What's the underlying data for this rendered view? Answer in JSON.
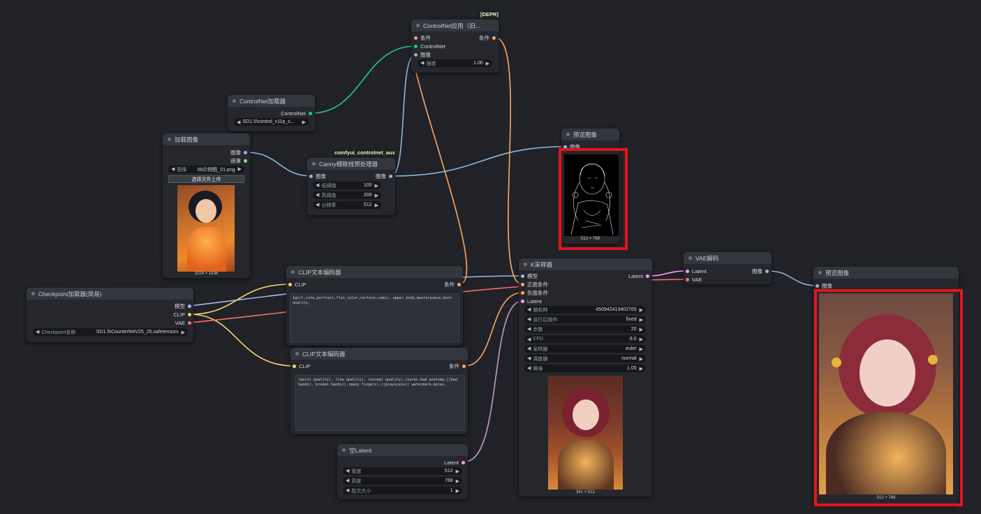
{
  "colors": {
    "model": "#a9b4e8",
    "clip": "#ffd36e",
    "vae": "#ff6e6e",
    "conditioning": "#ffa763",
    "controlnet": "#22c98a",
    "image": "#8fb8dc",
    "latent": "#ff9cf9",
    "mask": "#8fde8a",
    "highlight": "#e3151b"
  },
  "badges": {
    "depr": "[DEPR]",
    "aux": "comfyui_controlnet_aux"
  },
  "controlnet_apply": {
    "title": "ControlNet应用（旧...",
    "in_conditioning": "条件",
    "in_controlnet": "ControlNet",
    "in_image": "图像",
    "out_conditioning": "条件",
    "strength_label": "强度",
    "strength_value": "1.00"
  },
  "controlnet_loader": {
    "title": "ControlNet加载器",
    "out_controlnet": "ControlNet",
    "model_value": "SD1.5\\control_v11p_s..."
  },
  "load_image": {
    "title": "加载图像",
    "out_image": "图像",
    "out_mask": "遮罩",
    "image_label": "图像",
    "image_value": "08示例图_01.png",
    "upload_button": "选择文件上传",
    "size": "1024 × 1536"
  },
  "canny": {
    "title": "Canny细致线预处理器",
    "in_image": "图像",
    "out_image": "图像",
    "low_label": "低阈值",
    "low_value": "100",
    "high_label": "高阈值",
    "high_value": "200",
    "res_label": "分辨率",
    "res_value": "512"
  },
  "preview1": {
    "title": "预览图像",
    "in_image": "图像",
    "size": "512 × 768"
  },
  "checkpoint": {
    "title": "Checkpoint加载器(简易)",
    "out_model": "模型",
    "out_clip": "CLIP",
    "out_vae": "VAE",
    "ckpt_label": "Checkpoint名称",
    "ckpt_value": "SD1.5\\CounterfeitV25_25.safetensors"
  },
  "clip_pos": {
    "title": "CLIP文本编码器",
    "in_clip": "CLIP",
    "out_conditioning": "条件",
    "text": "1girl,cute,portrait,flat_color,cartoon,comic, upper_body,masterpiece,best quality,"
  },
  "clip_neg": {
    "title": "CLIP文本编码器",
    "in_clip": "CLIP",
    "out_conditioning": "条件",
    "text": "(worst quality), (low quality), (normal quality),lowres,bad anatomy,((bad hands), broken hands)),(many fingers),((grayscale)) watermark,moles,"
  },
  "empty_latent": {
    "title": "空Latent",
    "out_latent": "Latent",
    "width_label": "宽度",
    "width_value": "512",
    "height_label": "高度",
    "height_value": "768",
    "batch_label": "批次大小",
    "batch_value": "1"
  },
  "ksampler": {
    "title": "K采样器",
    "in_model": "模型",
    "in_positive": "正面条件",
    "in_negative": "负面条件",
    "in_latent": "Latent",
    "out_latent": "Latent",
    "seed_label": "随机种",
    "seed_value": "450942413402765",
    "control_label": "运行后操作",
    "control_value": "fixed",
    "steps_label": "步数",
    "steps_value": "20",
    "cfg_label": "CFG",
    "cfg_value": "8.0",
    "sampler_label": "采样器",
    "sampler_value": "euler",
    "scheduler_label": "调度器",
    "scheduler_value": "normal",
    "denoise_label": "降噪",
    "denoise_value": "1.00",
    "size": "341 × 512"
  },
  "vae_decode": {
    "title": "VAE解码",
    "in_latent": "Latent",
    "in_vae": "VAE",
    "out_image": "图像"
  },
  "preview2": {
    "title": "预览图像",
    "in_image": "图像",
    "size": "512 × 768"
  }
}
